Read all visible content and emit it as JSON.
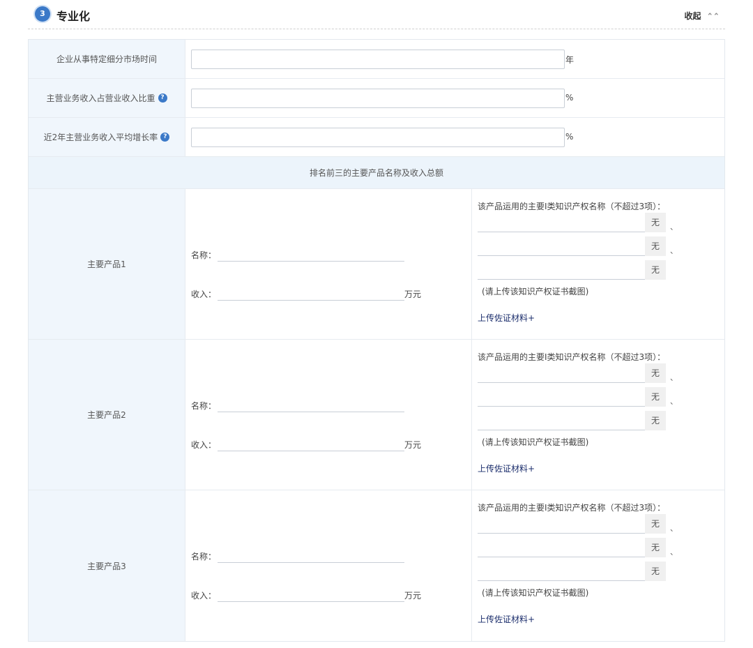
{
  "section": {
    "step_number": "3",
    "title": "专业化",
    "collapse_label": "收起",
    "collapse_icon": "chevron-double-up-icon"
  },
  "fields": [
    {
      "label": "企业从事特定细分市场时间",
      "value": "",
      "unit": "年",
      "has_help": false
    },
    {
      "label": "主营业务收入占营业收入比重",
      "value": "",
      "unit": "%",
      "has_help": true
    },
    {
      "label": "近2年主营业务收入平均增长率",
      "value": "",
      "unit": "%",
      "has_help": true
    }
  ],
  "help_icon_glyph": "?",
  "products_heading": "排名前三的主要产品名称及收入总额",
  "products": [
    {
      "label": "主要产品1",
      "name_label": "名称：",
      "name_value": "",
      "revenue_label": "收入：",
      "revenue_value": "",
      "revenue_unit": "万元"
    },
    {
      "label": "主要产品2",
      "name_label": "名称：",
      "name_value": "",
      "revenue_label": "收入：",
      "revenue_value": "",
      "revenue_unit": "万元"
    },
    {
      "label": "主要产品3",
      "name_label": "名称：",
      "name_value": "",
      "revenue_label": "收入：",
      "revenue_value": "",
      "revenue_unit": "万元"
    }
  ],
  "ip": {
    "title": "该产品运用的主要I类知识产权名称（不超过3项）：",
    "none_button": "无",
    "separator": "、",
    "hint": "(请上传该知识产权证书截图)",
    "upload_label": "上传佐证材料+"
  },
  "colors": {
    "accent": "#3b79c8",
    "label_bg": "#f0f6fc",
    "heading_bg": "#ecf4fb",
    "link": "#1a2c6b"
  }
}
